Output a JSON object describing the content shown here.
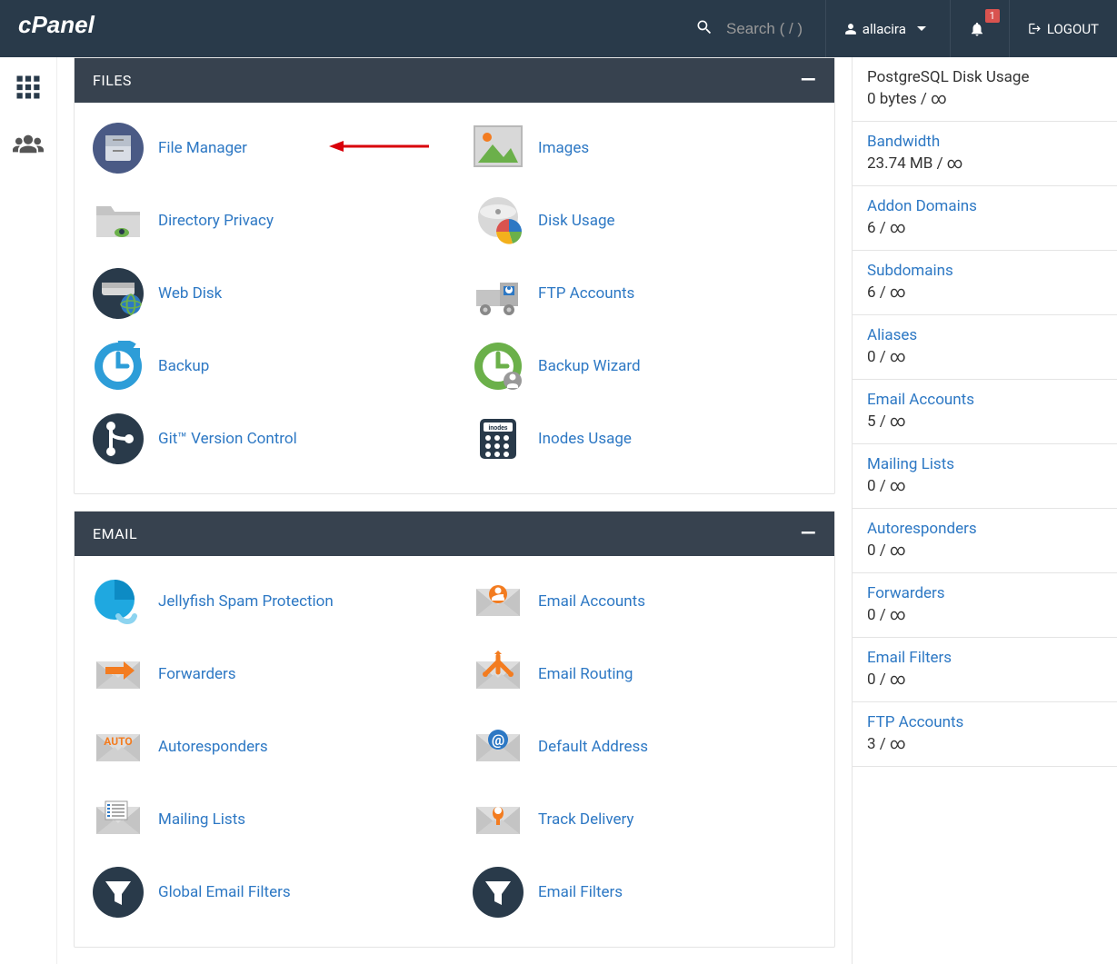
{
  "header": {
    "search_placeholder": "Search ( / )",
    "username": "allacira",
    "notif_count": "1",
    "logout": "LOGOUT"
  },
  "panels": [
    {
      "title": "FILES",
      "items": [
        {
          "label": "File Manager",
          "icon": "filemgr",
          "arrow": true
        },
        {
          "label": "Images",
          "icon": "images"
        },
        {
          "label": "Directory Privacy",
          "icon": "dirprivacy"
        },
        {
          "label": "Disk Usage",
          "icon": "diskusage"
        },
        {
          "label": "Web Disk",
          "icon": "webdisk"
        },
        {
          "label": "FTP Accounts",
          "icon": "ftp"
        },
        {
          "label": "Backup",
          "icon": "backup"
        },
        {
          "label": "Backup Wizard",
          "icon": "backupwiz"
        },
        {
          "label": "Git™ Version Control",
          "icon": "git"
        },
        {
          "label": "Inodes Usage",
          "icon": "inodes"
        }
      ]
    },
    {
      "title": "EMAIL",
      "items": [
        {
          "label": "Jellyfish Spam Protection",
          "icon": "jellyfish"
        },
        {
          "label": "Email Accounts",
          "icon": "emailacct"
        },
        {
          "label": "Forwarders",
          "icon": "forwarders"
        },
        {
          "label": "Email Routing",
          "icon": "routing"
        },
        {
          "label": "Autoresponders",
          "icon": "autoresp"
        },
        {
          "label": "Default Address",
          "icon": "defaddr"
        },
        {
          "label": "Mailing Lists",
          "icon": "mailinglist"
        },
        {
          "label": "Track Delivery",
          "icon": "trackdel"
        },
        {
          "label": "Global Email Filters",
          "icon": "globfilter"
        },
        {
          "label": "Email Filters",
          "icon": "emailfilter"
        }
      ]
    }
  ],
  "stats": [
    {
      "label": "PostgreSQL Disk Usage",
      "value": "0 bytes / ∞",
      "link": false
    },
    {
      "label": "Bandwidth",
      "value": "23.74 MB / ∞",
      "link": true
    },
    {
      "label": "Addon Domains",
      "value": "6 / ∞",
      "link": true
    },
    {
      "label": "Subdomains",
      "value": "6 / ∞",
      "link": true
    },
    {
      "label": "Aliases",
      "value": "0 / ∞",
      "link": true
    },
    {
      "label": "Email Accounts",
      "value": "5 / ∞",
      "link": true
    },
    {
      "label": "Mailing Lists",
      "value": "0 / ∞",
      "link": true
    },
    {
      "label": "Autoresponders",
      "value": "0 / ∞",
      "link": true
    },
    {
      "label": "Forwarders",
      "value": "0 / ∞",
      "link": true
    },
    {
      "label": "Email Filters",
      "value": "0 / ∞",
      "link": true
    },
    {
      "label": "FTP Accounts",
      "value": "3 / ∞",
      "link": true
    }
  ]
}
